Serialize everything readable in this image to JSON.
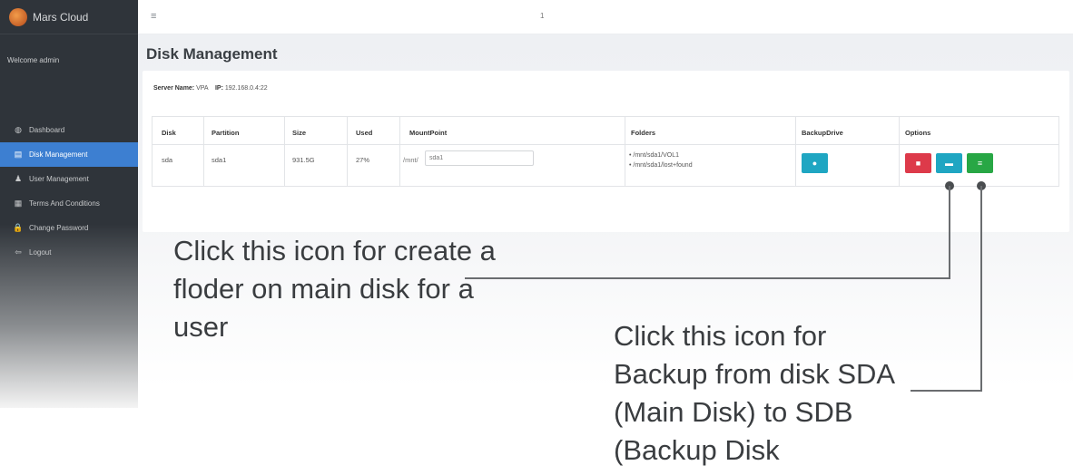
{
  "app": {
    "brand": "Mars Cloud",
    "welcome": "Welcome admin"
  },
  "sidebar": {
    "items": [
      {
        "icon": "dashboard-icon",
        "glyph": "◍",
        "label": "Dashboard"
      },
      {
        "icon": "disk-icon",
        "glyph": "▤",
        "label": "Disk Management"
      },
      {
        "icon": "user-icon",
        "glyph": "♟",
        "label": "User Management"
      },
      {
        "icon": "document-icon",
        "glyph": "▦",
        "label": "Terms And Conditions"
      },
      {
        "icon": "lock-icon",
        "glyph": "🔒",
        "label": "Change Password"
      },
      {
        "icon": "logout-icon",
        "glyph": "⇦",
        "label": "Logout"
      }
    ]
  },
  "topbar": {
    "menu_glyph": "≡",
    "count": "1"
  },
  "page": {
    "title": "Disk Management"
  },
  "server": {
    "name_label": "Server Name:",
    "name": "VPA",
    "ip_label": "IP:",
    "ip": "192.168.0.4:22"
  },
  "table": {
    "headers": [
      "Disk",
      "Partition",
      "Size",
      "Used",
      "MountPoint",
      "Folders",
      "BackupDrive",
      "Options"
    ],
    "rows": [
      {
        "disk": "sda",
        "partition": "sda1",
        "size": "931.5G",
        "used": "27%",
        "mount_prefix": "/mnt/",
        "mount_value": "sda1",
        "folders": [
          "/mnt/sda1/VOL1",
          "/mnt/sda1/lost+found"
        ]
      }
    ]
  },
  "annotations": {
    "folder_note": "Click this icon for create a floder on main disk for a user",
    "backup_note": "Click this icon for Backup from disk SDA (Main Disk) to SDB (Backup Disk"
  },
  "colors": {
    "sidebar_bg": "#2f343a",
    "active": "#3d7fd1",
    "info": "#1fa6c2",
    "danger": "#dd3a4a",
    "success": "#28a745"
  }
}
